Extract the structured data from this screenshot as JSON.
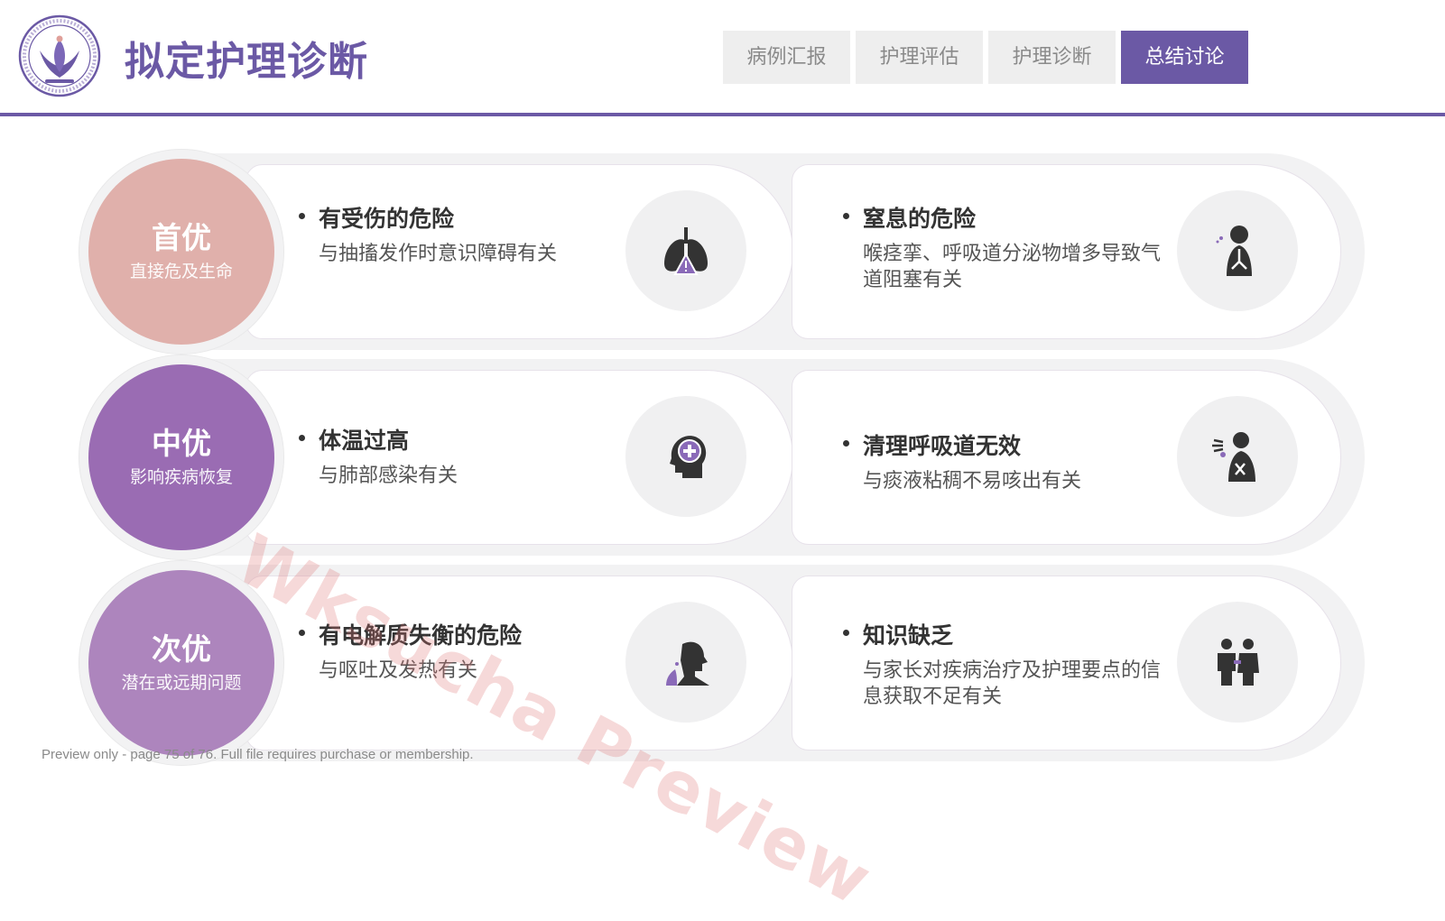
{
  "header": {
    "title": "拟定护理诊断",
    "tabs": [
      {
        "label": "病例汇报",
        "active": false
      },
      {
        "label": "护理评估",
        "active": false
      },
      {
        "label": "护理诊断",
        "active": false
      },
      {
        "label": "总结讨论",
        "active": true
      }
    ],
    "accent": "#6b59a5"
  },
  "rows": [
    {
      "level": "首优",
      "level_desc": "直接危及生命",
      "color": "#e0b0ab",
      "items": [
        {
          "title": "有受伤的危险",
          "desc": "与抽搐发作时意识障碍有关",
          "icon": "lungs-warning-icon"
        },
        {
          "title": "窒息的危险",
          "desc": "喉痉挛、呼吸道分泌物增多导致气道阻塞有关",
          "icon": "respiratory-system-icon"
        }
      ]
    },
    {
      "level": "中优",
      "level_desc": "影响疾病恢复",
      "color": "#9a6cb3",
      "items": [
        {
          "title": "体温过高",
          "desc": "与肺部感染有关",
          "icon": "head-medical-cross-icon"
        },
        {
          "title": "清理呼吸道无效",
          "desc": "与痰液粘稠不易咳出有关",
          "icon": "cough-patient-icon"
        }
      ]
    },
    {
      "level": "次优",
      "level_desc": "潜在或远期问题",
      "color": "#ad85bd",
      "items": [
        {
          "title": "有电解质失衡的危险",
          "desc": "与呕吐及发热有关",
          "icon": "vomiting-person-icon"
        },
        {
          "title": "知识缺乏",
          "desc": "与家长对疾病治疗及护理要点的信息获取不足有关",
          "icon": "parents-icon"
        }
      ]
    }
  ],
  "watermark": "Wksucha Preview",
  "footer_note": "Preview only - page 75 of 76. Full file requires purchase or membership."
}
